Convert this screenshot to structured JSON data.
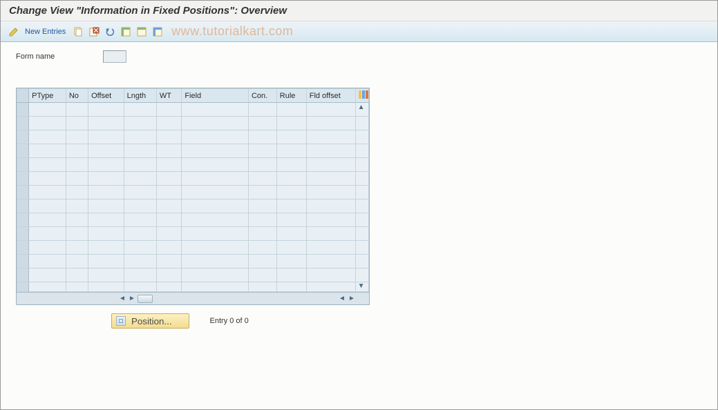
{
  "title": "Change View \"Information in Fixed Positions\": Overview",
  "toolbar": {
    "new_entries": "New Entries"
  },
  "watermark": "www.tutorialkart.com",
  "form": {
    "name_label": "Form name",
    "name_value": ""
  },
  "table": {
    "columns": [
      "PType",
      "No",
      "Offset",
      "Lngth",
      "WT",
      "Field",
      "Con.",
      "Rule",
      "Fld offset"
    ],
    "rows": [
      [
        "",
        "",
        "",
        "",
        "",
        "",
        "",
        "",
        ""
      ],
      [
        "",
        "",
        "",
        "",
        "",
        "",
        "",
        "",
        ""
      ],
      [
        "",
        "",
        "",
        "",
        "",
        "",
        "",
        "",
        ""
      ],
      [
        "",
        "",
        "",
        "",
        "",
        "",
        "",
        "",
        ""
      ],
      [
        "",
        "",
        "",
        "",
        "",
        "",
        "",
        "",
        ""
      ],
      [
        "",
        "",
        "",
        "",
        "",
        "",
        "",
        "",
        ""
      ],
      [
        "",
        "",
        "",
        "",
        "",
        "",
        "",
        "",
        ""
      ],
      [
        "",
        "",
        "",
        "",
        "",
        "",
        "",
        "",
        ""
      ],
      [
        "",
        "",
        "",
        "",
        "",
        "",
        "",
        "",
        ""
      ],
      [
        "",
        "",
        "",
        "",
        "",
        "",
        "",
        "",
        ""
      ],
      [
        "",
        "",
        "",
        "",
        "",
        "",
        "",
        "",
        ""
      ],
      [
        "",
        "",
        "",
        "",
        "",
        "",
        "",
        "",
        ""
      ],
      [
        "",
        "",
        "",
        "",
        "",
        "",
        "",
        "",
        ""
      ],
      [
        "",
        "",
        "",
        "",
        "",
        "",
        "",
        "",
        ""
      ]
    ]
  },
  "footer": {
    "position_label": "Position...",
    "entry_text": "Entry 0 of 0"
  },
  "colors": {
    "toolbar_bg": "#d7e8f1",
    "table_bg": "#e9f0f5",
    "button_bg": "#f3dd8e"
  }
}
